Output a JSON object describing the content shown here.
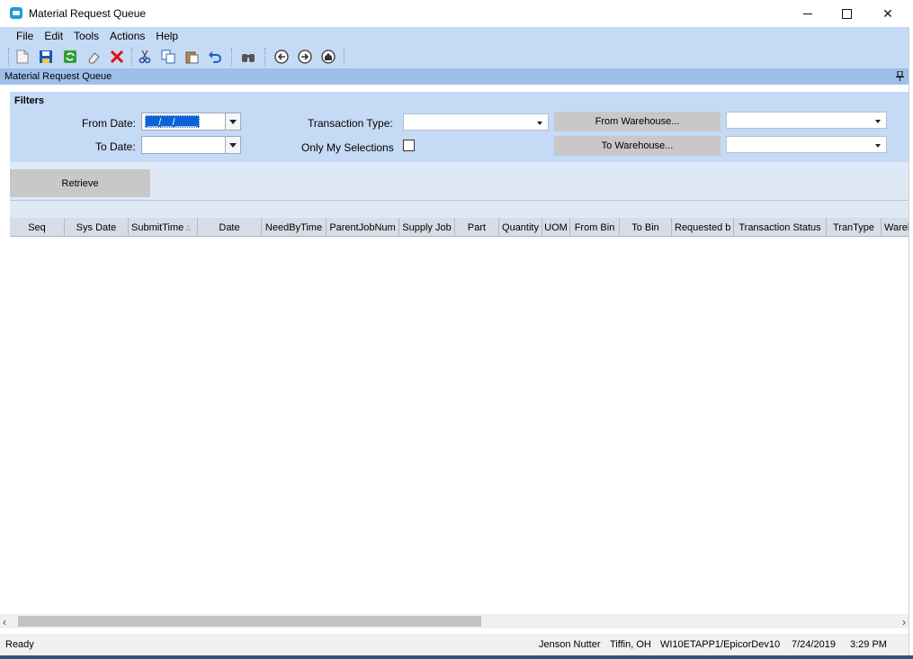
{
  "window": {
    "title": "Material Request Queue",
    "minimize_glyph": "",
    "maximize_glyph": "",
    "close_glyph": "✕"
  },
  "menu": [
    "File",
    "Edit",
    "Tools",
    "Actions",
    "Help"
  ],
  "toolbar": {
    "icons": [
      "new-icon",
      "save-icon",
      "refresh-icon",
      "clear-icon",
      "delete-icon",
      "cut-icon",
      "copy-icon",
      "paste-icon",
      "undo-icon",
      "search-icon",
      "back-icon",
      "forward-icon",
      "home-icon"
    ]
  },
  "panel": {
    "title": "Material Request Queue"
  },
  "filters": {
    "group_label": "Filters",
    "from_date_label": "From Date:",
    "from_date_value": "__/__/____",
    "to_date_label": "To Date:",
    "to_date_value": "",
    "transaction_type_label": "Transaction Type:",
    "transaction_type_value": "",
    "only_my_selections_label": "Only My Selections",
    "only_my_selections_checked": false,
    "from_warehouse_button": "From Warehouse...",
    "from_warehouse_value": "",
    "to_warehouse_button": "To Warehouse...",
    "to_warehouse_value": ""
  },
  "retrieve_button": "Retrieve",
  "grid": {
    "columns": [
      {
        "label": "Seq"
      },
      {
        "label": "Sys Date"
      },
      {
        "label": "SubmitTime",
        "sort": "△"
      },
      {
        "label": "Date"
      },
      {
        "label": "NeedByTime"
      },
      {
        "label": "ParentJobNum"
      },
      {
        "label": "Supply Job"
      },
      {
        "label": "Part"
      },
      {
        "label": "Quantity"
      },
      {
        "label": "UOM"
      },
      {
        "label": "From Bin"
      },
      {
        "label": "To Bin"
      },
      {
        "label": "Requested b"
      },
      {
        "label": "Transaction Status"
      },
      {
        "label": "TranType"
      },
      {
        "label": "Wareh"
      }
    ],
    "rows": []
  },
  "scrollbar": {
    "left_arrow": "‹",
    "right_arrow": "›"
  },
  "status": {
    "state": "Ready",
    "user": "Jenson Nutter",
    "location": "Tiffin, OH",
    "server": "WI10ETAPP1/EpicorDev10",
    "date": "7/24/2019",
    "time": "3:29 PM"
  }
}
